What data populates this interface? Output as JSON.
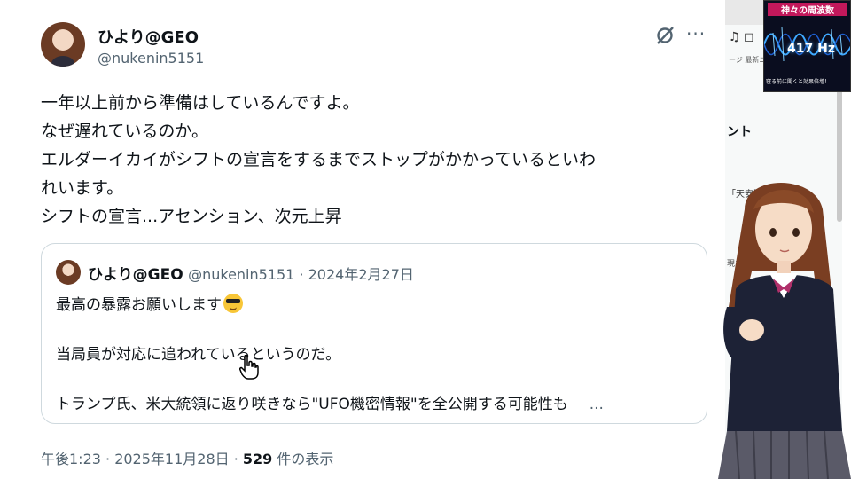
{
  "tweet": {
    "display_name": "ひより@GEO",
    "handle": "@nukenin5151",
    "more_label": "···",
    "text_lines": [
      "一年以上前から準備はしているんですよ。",
      "なぜ遅れているのか。",
      "エルダーイカイがシフトの宣言をするまでストップがかかっているといわ",
      "れいます。",
      "シフトの宣言...アセンション、次元上昇"
    ]
  },
  "quote": {
    "display_name": "ひより@GEO",
    "meta": "@nukenin5151 · 2024年2月27日",
    "line1": "最高の暴露お願いします",
    "line2": "当局員が対応に追われているというのだ。",
    "line3": "トランプ氏、米大統領に返り咲きなら\"UFO機密情報\"を全公開する可能性も",
    "ellipsis": "..."
  },
  "footer": {
    "time_date": "午後1:23 · 2025年11月28日 · ",
    "views_count": "529",
    "views_label": " 件の表示"
  },
  "sidebar": {
    "icons": "♫ ◻",
    "small_text": "ージ 最新ニ",
    "heading": "ント",
    "item1": "「天安門",
    "item2": "現ホス"
  },
  "video": {
    "title": "神々の周波数",
    "hz": "417 Hz",
    "caption": "寝る前に聞くと効果倍増！"
  },
  "icons": {
    "grok": "grok-icon",
    "cursor": "hand-cursor-icon",
    "emoji": "sunglasses-emoji-icon"
  }
}
